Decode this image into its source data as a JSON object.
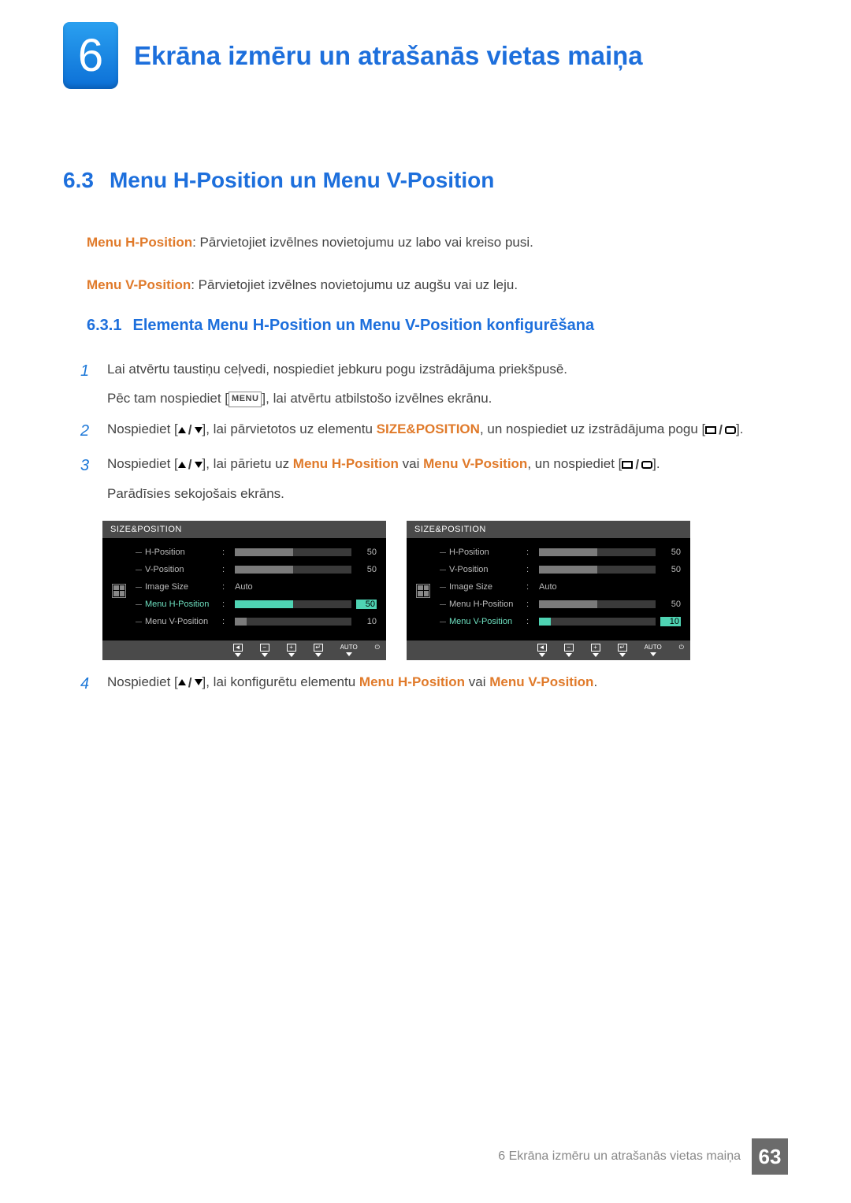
{
  "chapter": {
    "number": "6",
    "title": "Ekrāna izmēru un atrašanās vietas maiņa"
  },
  "section": {
    "number": "6.3",
    "title": "Menu H-Position un Menu V-Position"
  },
  "definitions": {
    "h": {
      "term": "Menu H-Position",
      "text": ": Pārvietojiet izvēlnes novietojumu uz labo vai kreiso pusi."
    },
    "v": {
      "term": "Menu V-Position",
      "text": ": Pārvietojiet izvēlnes novietojumu uz augšu vai uz leju."
    }
  },
  "subsection": {
    "number": "6.3.1",
    "title": "Elementa Menu H-Position un Menu V-Position konfigurēšana"
  },
  "steps": {
    "s1": {
      "num": "1",
      "a": "Lai atvērtu taustiņu ceļvedi, nospiediet jebkuru pogu izstrādājuma priekšpusē.",
      "b_pre": "Pēc tam nospiediet [",
      "b_btn": "MENU",
      "b_post": "], lai atvērtu atbilstošo izvēlnes ekrānu."
    },
    "s2": {
      "num": "2",
      "pre": "Nospiediet [",
      "mid": "], lai pārvietotos uz elementu ",
      "hl": "SIZE&POSITION",
      "post1": ", un nospiediet uz izstrādājuma pogu [",
      "post2": "]."
    },
    "s3": {
      "num": "3",
      "pre": "Nospiediet [",
      "mid1": "], lai pārietu uz ",
      "hl1": "Menu H-Position",
      "mid2": " vai ",
      "hl2": "Menu V-Position",
      "mid3": ", un nospiediet [",
      "post": "].",
      "line2": "Parādīsies sekojošais ekrāns."
    },
    "s4": {
      "num": "4",
      "pre": "Nospiediet [",
      "mid": "], lai konfigurētu elementu ",
      "hl1": "Menu H-Position",
      "mid2": " vai ",
      "hl2": "Menu V-Position",
      "post": "."
    }
  },
  "osd_common": {
    "title": "SIZE&POSITION",
    "rows": {
      "hpos": {
        "label": "H-Position",
        "value": "50",
        "fill": 50
      },
      "vpos": {
        "label": "V-Position",
        "value": "50",
        "fill": 50
      },
      "imgsize": {
        "label": "Image Size",
        "value": "Auto"
      },
      "menuh": {
        "label": "Menu H-Position",
        "value": "50",
        "fill": 50
      },
      "menuv": {
        "label": "Menu V-Position",
        "value": "10",
        "fill": 10
      }
    },
    "footer": {
      "auto": "AUTO",
      "left": "◄",
      "minus": "−",
      "plus": "+",
      "enter": "↵",
      "power": "⏻"
    }
  },
  "footer": {
    "text": "6 Ekrāna izmēru un atrašanās vietas maiņa",
    "page": "63"
  }
}
